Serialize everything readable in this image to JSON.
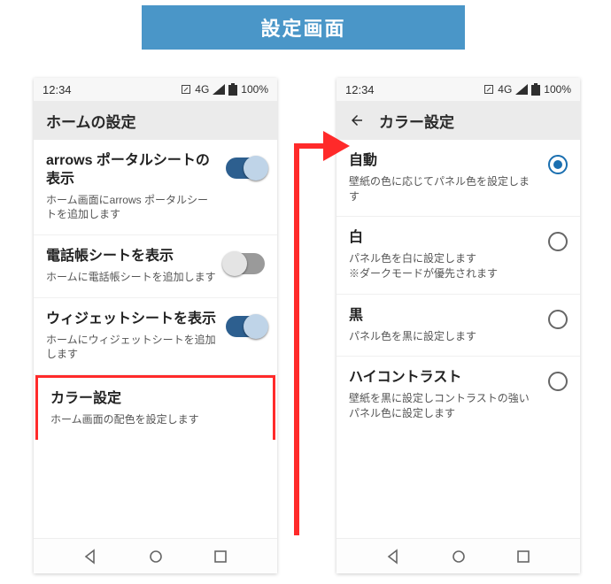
{
  "banner": "設定画面",
  "status": {
    "time": "12:34",
    "net": "4G",
    "battery": "100%"
  },
  "left": {
    "title": "ホームの設定",
    "items": [
      {
        "title": "arrows ポータルシートの表示",
        "desc": "ホーム画面にarrows ポータルシートを追加します",
        "switch": true
      },
      {
        "title": "電話帳シートを表示",
        "desc": "ホームに電話帳シートを追加します",
        "switch": false
      },
      {
        "title": "ウィジェットシートを表示",
        "desc": "ホームにウィジェットシートを追加します",
        "switch": true
      },
      {
        "title": "カラー設定",
        "desc": "ホーム画面の配色を設定します"
      }
    ]
  },
  "right": {
    "title": "カラー設定",
    "items": [
      {
        "title": "自動",
        "desc": "壁紙の色に応じてパネル色を設定します",
        "selected": true
      },
      {
        "title": "白",
        "desc": "パネル色を白に設定します\n※ダークモードが優先されます",
        "selected": false
      },
      {
        "title": "黒",
        "desc": "パネル色を黒に設定します",
        "selected": false
      },
      {
        "title": "ハイコントラスト",
        "desc": "壁紙を黒に設定しコントラストの強いパネル色に設定します",
        "selected": false
      }
    ]
  }
}
